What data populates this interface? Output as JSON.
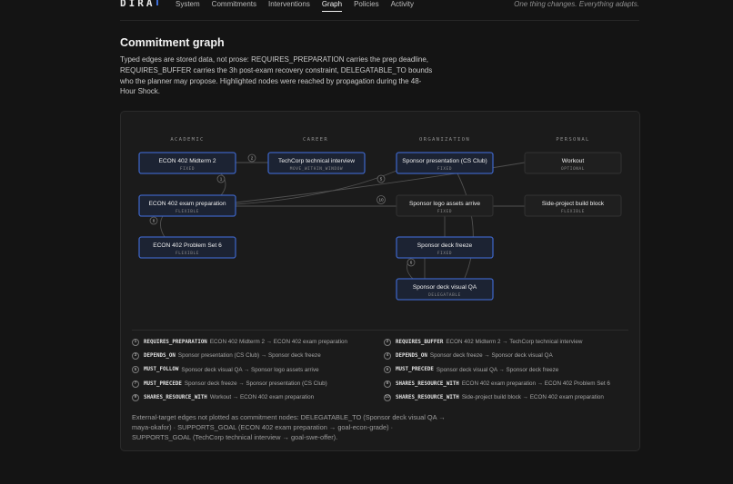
{
  "brand": "DIRA",
  "nav": [
    {
      "label": "System",
      "active": false
    },
    {
      "label": "Commitments",
      "active": false
    },
    {
      "label": "Interventions",
      "active": false
    },
    {
      "label": "Graph",
      "active": true
    },
    {
      "label": "Policies",
      "active": false
    },
    {
      "label": "Activity",
      "active": false
    }
  ],
  "tagline": "One thing changes. Everything adapts.",
  "page": {
    "title": "Commitment graph",
    "intro": "Typed edges are stored data, not prose: REQUIRES_PREPARATION carries the prep deadline, REQUIRES_BUFFER carries the 3h post-exam recovery constraint, DELEGATABLE_TO bounds who the planner may propose. Highlighted nodes were reached by propagation during the 48-Hour Shock."
  },
  "graph": {
    "columns": [
      "ACADEMIC",
      "CAREER",
      "ORGANIZATION",
      "PERSONAL"
    ],
    "nodes": [
      {
        "title": "ECON 402 Midterm 2",
        "sub": "FIXED",
        "highlighted": true
      },
      {
        "title": "ECON 402 exam preparation",
        "sub": "FLEXIBLE",
        "highlighted": true
      },
      {
        "title": "ECON 402 Problem Set 6",
        "sub": "FLEXIBLE",
        "highlighted": true
      },
      {
        "title": "TechCorp technical interview",
        "sub": "MOVE_WITHIN_WINDOW",
        "highlighted": true
      },
      {
        "title": "Sponsor presentation (CS Club)",
        "sub": "FIXED",
        "highlighted": true
      },
      {
        "title": "Sponsor logo assets arrive",
        "sub": "FIXED",
        "highlighted": false
      },
      {
        "title": "Sponsor deck freeze",
        "sub": "FIXED",
        "highlighted": true
      },
      {
        "title": "Sponsor deck visual QA",
        "sub": "DELEGATABLE",
        "highlighted": true
      },
      {
        "title": "Workout",
        "sub": "OPTIONAL",
        "highlighted": false
      },
      {
        "title": "Side-project build block",
        "sub": "FLEXIBLE",
        "highlighted": false
      }
    ],
    "edge_numbers": [
      "1",
      "2",
      "3",
      "4",
      "5",
      "6",
      "7",
      "8",
      "9",
      "10"
    ]
  },
  "legend": [
    {
      "num": "1",
      "type": "REQUIRES_PREPARATION",
      "text": "ECON 402 Midterm 2 → ECON 402 exam preparation"
    },
    {
      "num": "2",
      "type": "REQUIRES_BUFFER",
      "text": "ECON 402 Midterm 2 → TechCorp technical interview"
    },
    {
      "num": "3",
      "type": "DEPENDS_ON",
      "text": "Sponsor presentation (CS Club) → Sponsor deck freeze"
    },
    {
      "num": "4",
      "type": "DEPENDS_ON",
      "text": "Sponsor deck freeze → Sponsor deck visual QA"
    },
    {
      "num": "5",
      "type": "MUST_FOLLOW",
      "text": "Sponsor deck visual QA → Sponsor logo assets arrive"
    },
    {
      "num": "6",
      "type": "MUST_PRECEDE",
      "text": "Sponsor deck visual QA → Sponsor deck freeze"
    },
    {
      "num": "7",
      "type": "MUST_PRECEDE",
      "text": "Sponsor deck freeze → Sponsor presentation (CS Club)"
    },
    {
      "num": "8",
      "type": "SHARES_RESOURCE_WITH",
      "text": "ECON 402 exam preparation → ECON 402 Problem Set 6"
    },
    {
      "num": "9",
      "type": "SHARES_RESOURCE_WITH",
      "text": "Workout → ECON 402 exam preparation"
    },
    {
      "num": "10",
      "type": "SHARES_RESOURCE_WITH",
      "text": "Side-project build block → ECON 402 exam preparation"
    }
  ],
  "footer": "External-target edges not plotted as commitment nodes: DELEGATABLE_TO (Sponsor deck visual QA → maya-okafor) · SUPPORTS_GOAL (ECON 402 exam preparation → goal-econ-grade) · SUPPORTS_GOAL (TechCorp technical interview → goal-swe-offer)."
}
